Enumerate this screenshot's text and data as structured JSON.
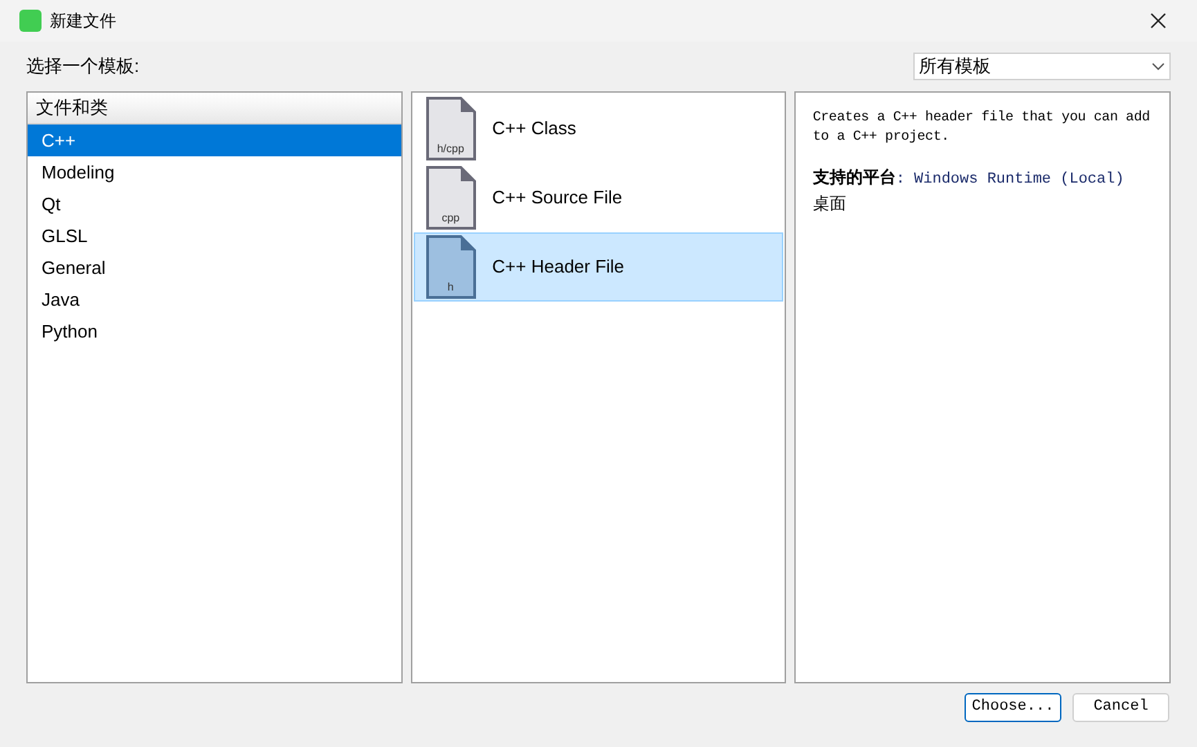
{
  "window": {
    "title": "新建文件"
  },
  "template_label": "选择一个模板:",
  "filter": {
    "value": "所有模板"
  },
  "categories": {
    "header": "文件和类",
    "items": [
      {
        "label": "C++",
        "selected": true
      },
      {
        "label": "Modeling",
        "selected": false
      },
      {
        "label": "Qt",
        "selected": false
      },
      {
        "label": "GLSL",
        "selected": false
      },
      {
        "label": "General",
        "selected": false
      },
      {
        "label": "Java",
        "selected": false
      },
      {
        "label": "Python",
        "selected": false
      }
    ]
  },
  "templates": [
    {
      "label": "C++ Class",
      "icon_text": "h/cpp",
      "selected": false
    },
    {
      "label": "C++ Source File",
      "icon_text": "cpp",
      "selected": false
    },
    {
      "label": "C++ Header File",
      "icon_text": "h",
      "selected": true
    }
  ],
  "description": {
    "text": "Creates a C++ header file that you can add to a C++ project.",
    "platforms_label": "支持的平台",
    "platforms_value": ": Windows Runtime (Local)",
    "platforms_extra": "桌面"
  },
  "buttons": [
    "Choose...",
    "Cancel"
  ]
}
